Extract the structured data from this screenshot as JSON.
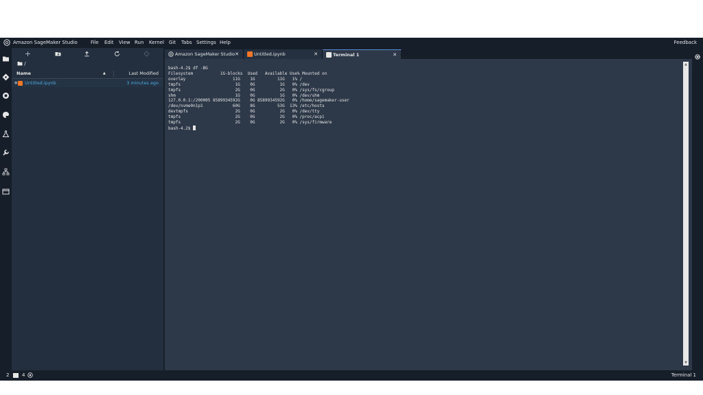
{
  "app": {
    "name": "Amazon SageMaker Studio",
    "menu": [
      "File",
      "Edit",
      "View",
      "Run",
      "Kernel",
      "Git",
      "Tabs",
      "Settings",
      "Help"
    ],
    "feedback": "Feedback"
  },
  "activity_bar": {
    "icons": [
      "folder-icon",
      "git-icon",
      "running-icon",
      "palette-icon",
      "flask-icon",
      "wrench-icon",
      "network-icon",
      "window-icon"
    ]
  },
  "file_browser": {
    "toolbar": [
      "new-launcher-icon",
      "new-folder-icon",
      "upload-icon",
      "refresh-icon",
      "git-clone-icon"
    ],
    "breadcrumb": "/",
    "columns": {
      "name": "Name",
      "modified": "Last Modified"
    },
    "files": [
      {
        "name": "Untitled.ipynb",
        "modified": "3 minutes ago"
      }
    ]
  },
  "tabs": [
    {
      "label": "Amazon SageMaker Studio",
      "close": "✕",
      "active": false
    },
    {
      "label": "Untitled.ipynb",
      "close": "✕",
      "active": false
    },
    {
      "label": "Terminal 1",
      "close": "✕",
      "active": true
    }
  ],
  "terminal": {
    "lines": [
      "bash-4.2$ df -BG",
      "Filesystem           1G-blocks  Used   Available Use% Mounted on",
      "overlay                   11G    1G         11G   1% /",
      "tmpfs                      1G    0G          1G   0% /dev",
      "tmpfs                      2G    0G          2G   0% /sys/fs/cgroup",
      "shm                        1G    0G          1G   0% /dev/shm",
      "127.0.0.1:/200005 8589934592G    0G 8589934592G   0% /home/sagemaker-user",
      "/dev/nvme0n1p1            60G    8G         53G  13% /etc/hosts",
      "devtmpfs                   2G    0G          2G   0% /dev/tty",
      "tmpfs                      2G    0G          2G   0% /proc/acpi",
      "tmpfs                      2G    0G          2G   0% /sys/firmware"
    ],
    "prompt": "bash-4.2$ "
  },
  "status_bar": {
    "left_count_1": "2",
    "left_count_2": "4",
    "right_label": "Terminal 1"
  },
  "colors": {
    "background": "#232f3e",
    "chrome": "#161e2a",
    "terminal_bg": "#2d3848",
    "link": "#4aa8e0",
    "notebook_orange": "#f37626"
  }
}
